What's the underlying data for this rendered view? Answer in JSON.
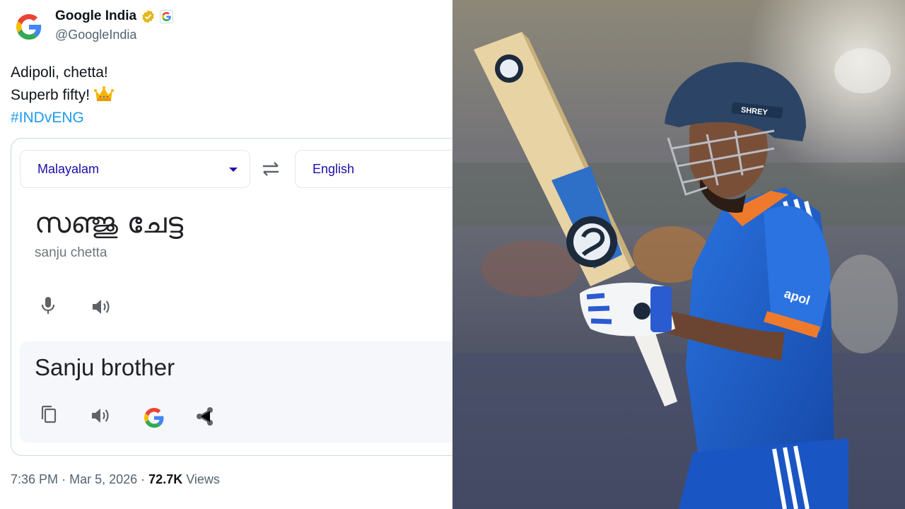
{
  "tweet": {
    "display_name": "Google India",
    "handle": "@GoogleIndia",
    "line1": "Adipoli, chetta!",
    "line2": "Superb fifty!",
    "hashtag": "#INDvENG",
    "time": "7:36 PM",
    "separator": "·",
    "date": "Mar 5, 2026",
    "views_count": "72.7K",
    "views_label": "Views"
  },
  "translate_card": {
    "source_language": "Malayalam",
    "target_language": "English",
    "source_text": "സഞ്ജു ചേട്ട",
    "transliteration": "sanju chetta",
    "translation": "Sanju brother"
  },
  "photo": {
    "helmet_label": "SHREY",
    "bat_brand_logo": "SG logo",
    "jersey_sponsor_partial": "apol"
  },
  "colors": {
    "link_blue": "#1d9bf0",
    "verified_gold": "#e2b719",
    "translate_link": "#1a0dab",
    "jersey_blue": "#1f5fcf",
    "jersey_orange": "#f07a2c"
  },
  "icons": [
    "google-g-logo",
    "verified-badge-icon",
    "affiliate-google-icon",
    "crown-emoji",
    "dropdown-arrow-icon",
    "swap-languages-icon",
    "microphone-icon",
    "speaker-icon",
    "copy-icon",
    "google-icon",
    "share-icon"
  ]
}
